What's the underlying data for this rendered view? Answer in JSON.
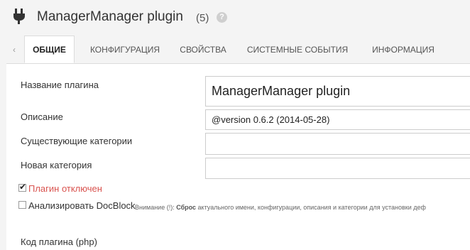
{
  "header": {
    "title": "ManagerManager plugin",
    "count": "(5)",
    "help_glyph": "?",
    "plug_icon": "plug-icon",
    "help_icon": "question-circle-icon"
  },
  "tabs": {
    "prev_glyph": "‹",
    "items": [
      {
        "label": "Общие",
        "active": true
      },
      {
        "label": "Конфигурация",
        "active": false
      },
      {
        "label": "Свойства",
        "active": false
      },
      {
        "label": "Системные события",
        "active": false
      },
      {
        "label": "Информация",
        "active": false
      }
    ]
  },
  "form": {
    "name_label": "Название плагина",
    "name_value": "ManagerManager plugin",
    "desc_label": "Описание",
    "desc_value": "@version 0.6.2 (2014-05-28)",
    "cats_label": "Существующие категории",
    "cats_value": "",
    "newcat_label": "Новая категория",
    "newcat_value": "",
    "disabled_label": "Плагин отключен",
    "disabled_checked": true,
    "analyze_label": "Анализировать DocBlock",
    "analyze_checked": false,
    "note_prefix": "Внимание (!): ",
    "note_bold": "Сброс",
    "note_rest": " актуального имени, конфигурации, описания и категории для установки деф",
    "code_label": "Код плагина (php)"
  },
  "colors": {
    "header_bg": "#f4f4f4",
    "danger": "#d9534f"
  }
}
